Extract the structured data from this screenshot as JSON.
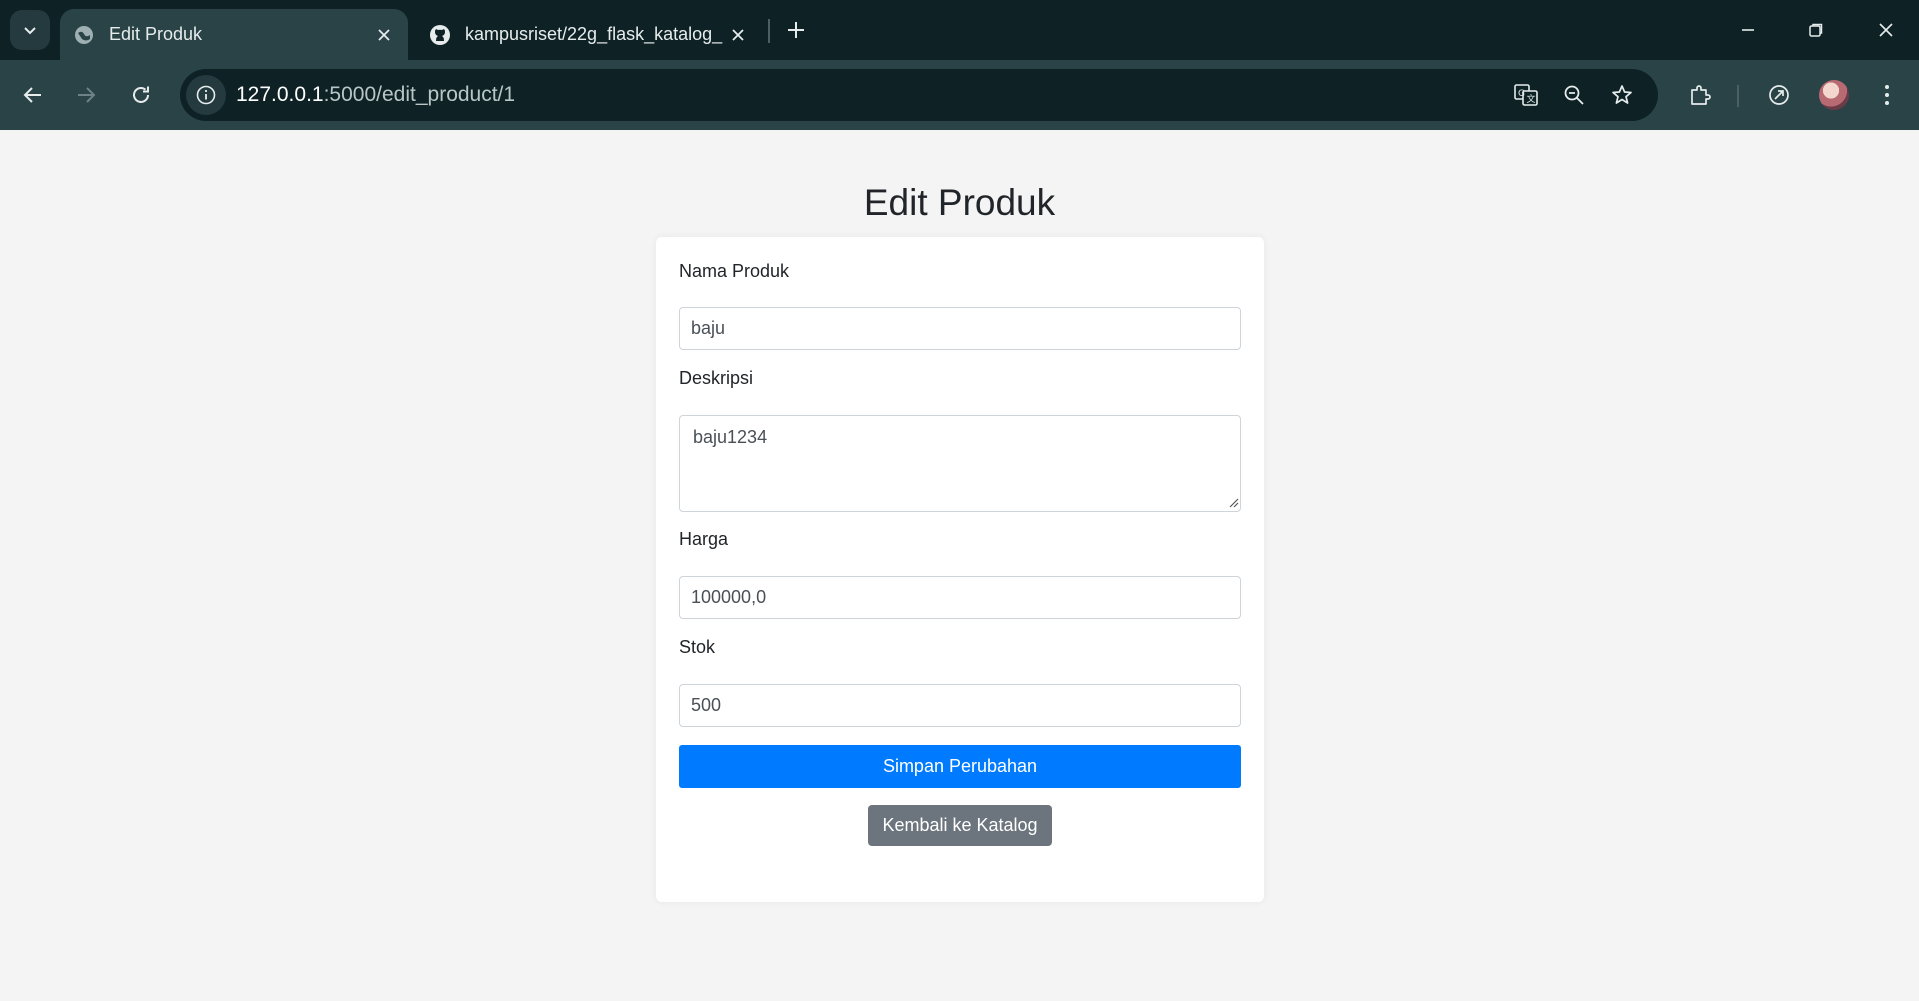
{
  "browser": {
    "tabs": [
      {
        "title": "Edit Produk",
        "favicon": "globe-icon",
        "active": true
      },
      {
        "title": "kampusriset/22g_flask_katalog_",
        "favicon": "github-icon",
        "active": false
      }
    ],
    "url": {
      "host": "127.0.0.1",
      "rest": ":5000/edit_product/1"
    },
    "colors": {
      "frame": "#0e2226",
      "toolbar": "#2a4347",
      "text": "#e6ecec"
    }
  },
  "page": {
    "title": "Edit Produk",
    "form": {
      "name_label": "Nama Produk",
      "name_value": "baju",
      "description_label": "Deskripsi",
      "description_value": "baju1234",
      "price_label": "Harga",
      "price_value": "100000,0",
      "stock_label": "Stok",
      "stock_value": "500",
      "submit_label": "Simpan Perubahan",
      "back_label": "Kembali ke Katalog"
    },
    "colors": {
      "primary": "#007bff",
      "secondary": "#6c757d",
      "background": "#f4f4f4"
    }
  }
}
